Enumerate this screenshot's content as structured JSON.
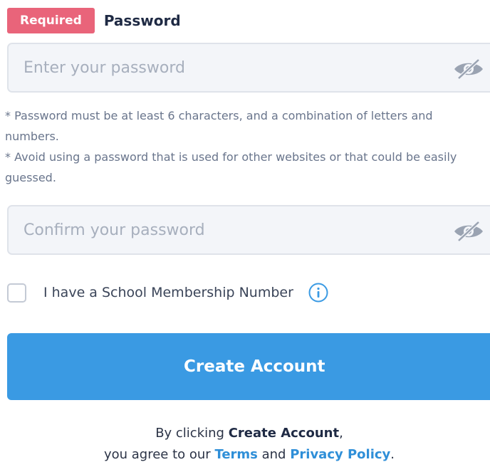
{
  "password_field": {
    "required_badge": "Required",
    "label": "Password",
    "placeholder": "Enter your password",
    "value": "",
    "toggle_icon": "eye-slash-icon"
  },
  "hints": [
    "* Password must be at least 6 characters, and a combination of letters and numbers.",
    "* Avoid using a password that is used for other websites or that could be easily guessed."
  ],
  "confirm_field": {
    "placeholder": "Confirm your password",
    "value": "",
    "toggle_icon": "eye-slash-icon"
  },
  "membership": {
    "label": "I have a School Membership Number",
    "checked": false,
    "info_icon": "info-icon"
  },
  "submit": {
    "label": "Create Account"
  },
  "legal": {
    "prefix": "By clicking ",
    "action": "Create Account",
    "suffix_line1": ",",
    "agree_text": "you agree to our ",
    "terms_link": "Terms",
    "and_text": " and ",
    "privacy_link": "Privacy Policy",
    "end": "."
  },
  "colors": {
    "badge": "#e9647a",
    "button": "#3a9ae3",
    "link": "#2f8fd8",
    "input_bg": "#f3f5f9"
  }
}
